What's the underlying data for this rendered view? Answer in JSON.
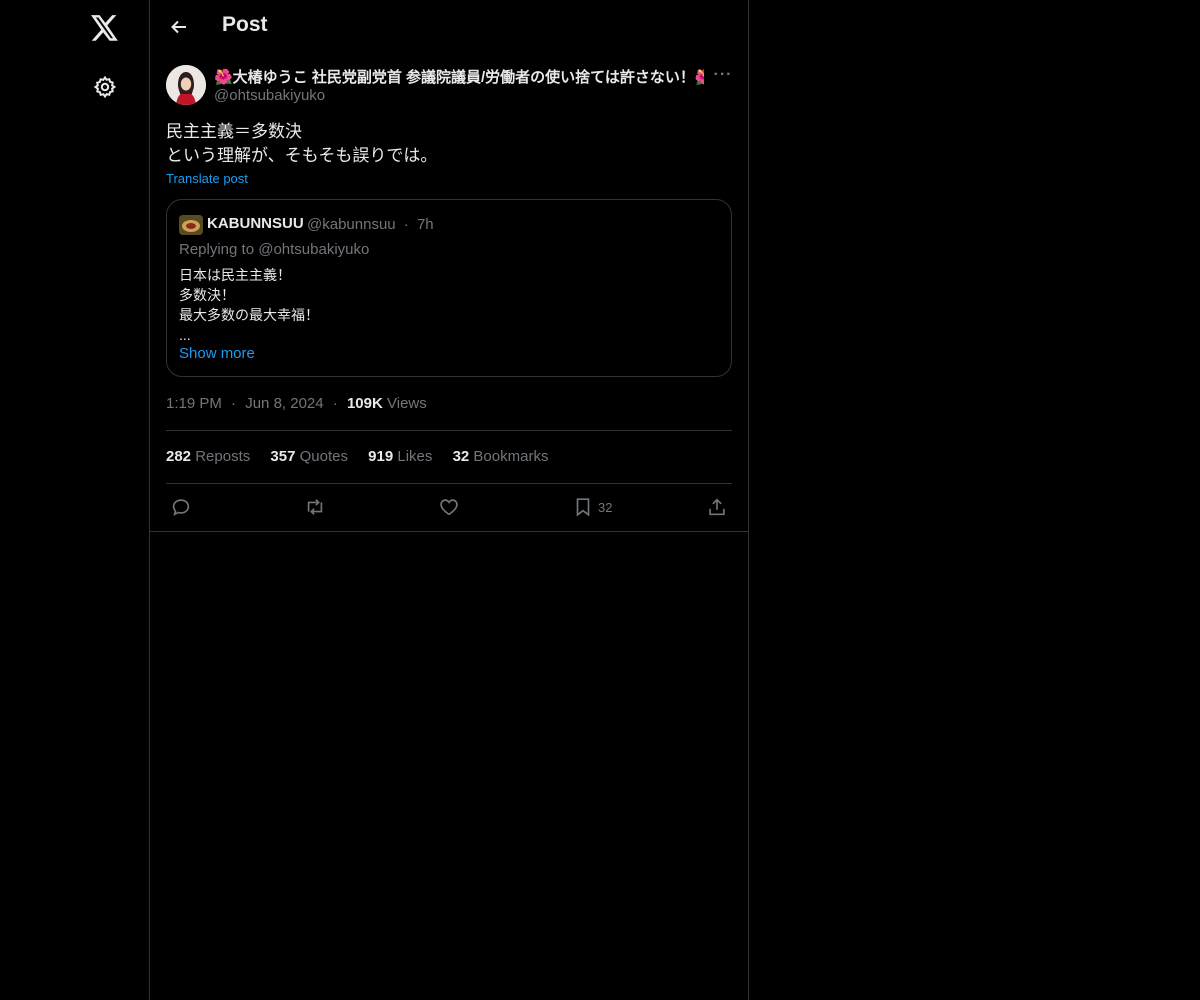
{
  "header": {
    "title": "Post"
  },
  "post": {
    "display_name": "🌺大椿ゆうこ 社民党副党首 参議院議員/労働者の使い捨ては許さない！🌺",
    "handle": "@ohtsubakiyuko",
    "text_lines": [
      "民主主義＝多数決",
      "という理解が、そもそも誤りでは。"
    ],
    "translate_label": "Translate post",
    "time": "1:19 PM",
    "date": "Jun 8, 2024",
    "views_count": "109K",
    "views_label": "Views",
    "sep": "·"
  },
  "quote": {
    "name": "KABUNNSUU",
    "handle": "@kabunnsuu",
    "sep": "·",
    "time": "7h",
    "replying_to": "Replying to @ohtsubakiyuko",
    "lines": [
      "日本は民主主義！",
      "多数決！",
      "最大多数の最大幸福！",
      "..."
    ],
    "show_more": "Show more"
  },
  "stats": {
    "reposts_count": "282",
    "reposts_label": "Reposts",
    "quotes_count": "357",
    "quotes_label": "Quotes",
    "likes_count": "919",
    "likes_label": "Likes",
    "bookmarks_count": "32",
    "bookmarks_label": "Bookmarks"
  },
  "actions": {
    "reply_icon": "reply-icon",
    "repost_icon": "repost-icon",
    "like_icon": "heart-icon",
    "bookmark_icon": "bookmark-icon",
    "bookmark_count": "32",
    "share_icon": "share-icon"
  },
  "sidebar": {
    "logo_icon": "x-logo-icon",
    "settings_icon": "gear-icon"
  },
  "colors": {
    "background": "#000000",
    "text": "#e7e9ea",
    "muted": "#71767b",
    "link": "#1d9bf0",
    "border": "#2f3336"
  }
}
